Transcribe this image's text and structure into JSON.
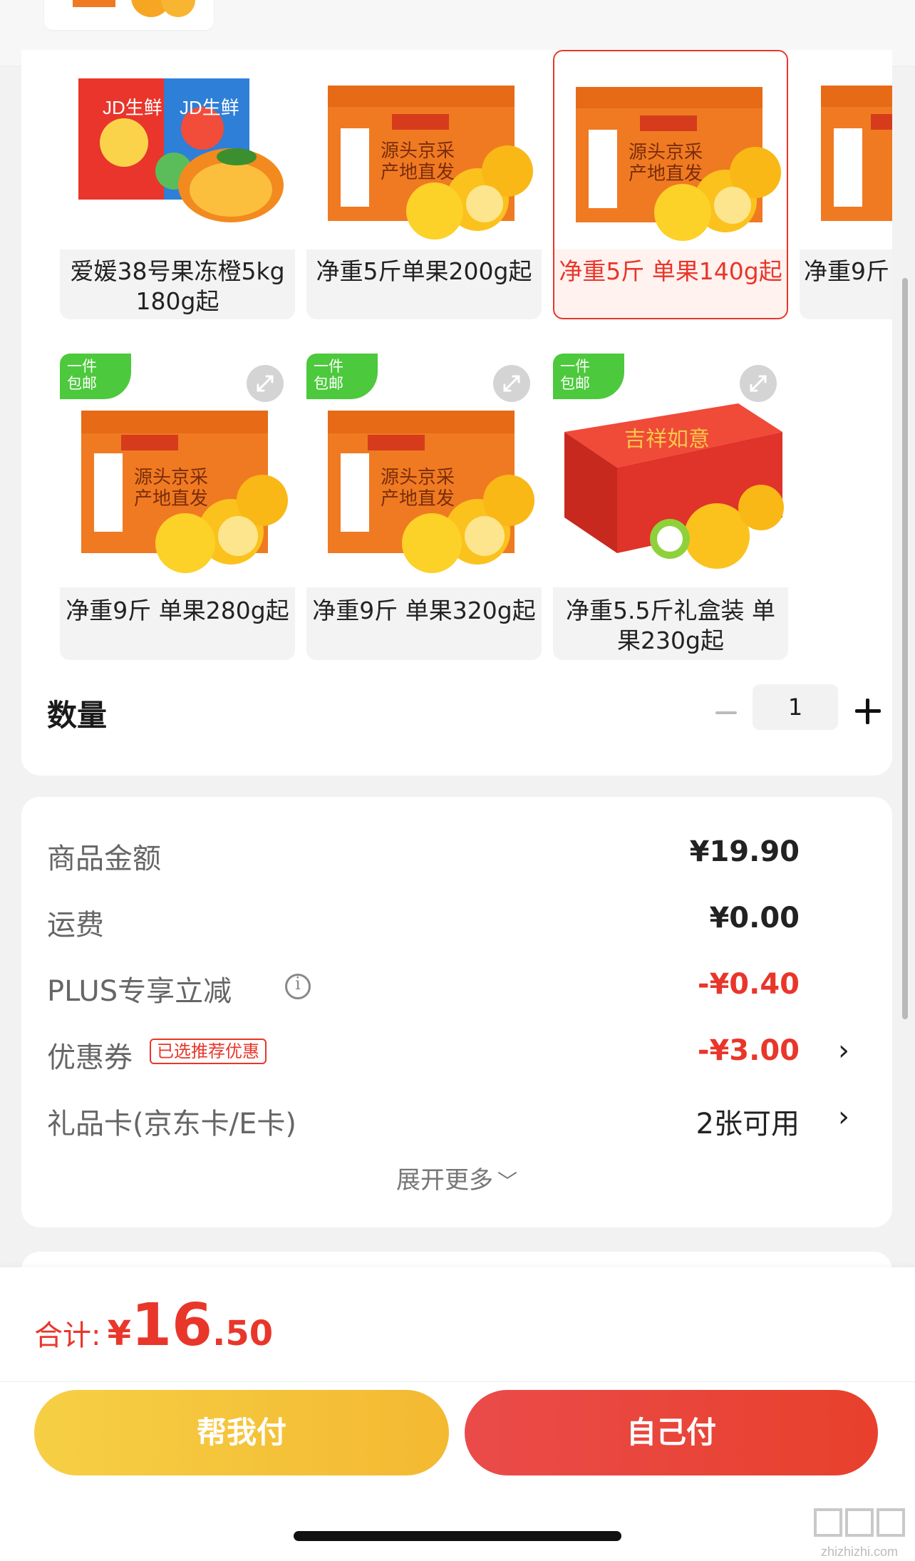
{
  "sku_options": [
    {
      "label": "爱媛38号果冻橙5kg 180g起",
      "selected": false,
      "badge": "",
      "image": "jd-fresh-box"
    },
    {
      "label": "净重5斤单果200g起",
      "selected": false,
      "badge": "",
      "image": "orange-box"
    },
    {
      "label": "净重5斤 单果140g起",
      "selected": true,
      "badge": "",
      "image": "orange-box"
    },
    {
      "label": "净重9斤",
      "selected": false,
      "badge": "",
      "image": "orange-box"
    },
    {
      "label": "净重9斤 单果280g起",
      "selected": false,
      "badge": "一件包邮",
      "image": "orange-box"
    },
    {
      "label": "净重9斤 单果320g起",
      "selected": false,
      "badge": "一件包邮",
      "image": "orange-box"
    },
    {
      "label": "净重5.5斤礼盒装 单果230g起",
      "selected": false,
      "badge": "一件包邮",
      "image": "red-gift-box"
    }
  ],
  "quantity": {
    "title": "数量",
    "value": "1"
  },
  "price_rows": {
    "goods_amount": {
      "label": "商品金额",
      "value": "¥19.90"
    },
    "shipping": {
      "label": "运费",
      "value": "¥0.00"
    },
    "plus_discount": {
      "label": "PLUS专享立减",
      "value": "-¥0.40"
    },
    "coupon": {
      "label": "优惠券",
      "tag": "已选推荐优惠",
      "value": "-¥3.00"
    },
    "gift_card": {
      "label": "礼品卡(京东卡/E卡)",
      "value": "2张可用"
    }
  },
  "expand_more": "展开更多",
  "total": {
    "label": "合计:",
    "currency": "¥",
    "integer": "16",
    "decimal": ".50"
  },
  "buttons": {
    "help_pay": "帮我付",
    "self_pay": "自己付"
  },
  "watermark": "zhizhizhi.com",
  "colors": {
    "accent_red": "#e9362a",
    "badge_green": "#4cc93c",
    "help_btn": "#f3b931",
    "self_btn": "#e8402c"
  }
}
